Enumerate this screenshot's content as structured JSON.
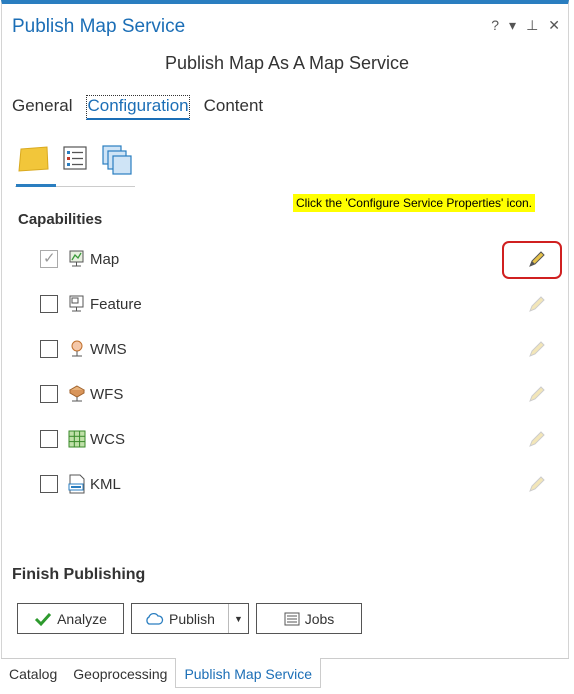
{
  "pane": {
    "title": "Publish Map Service",
    "controls": [
      "?",
      "▾",
      "⊥",
      "✕"
    ]
  },
  "subtitle": "Publish Map As A Map Service",
  "tabs": [
    {
      "label": "General",
      "active": false
    },
    {
      "label": "Configuration",
      "active": true
    },
    {
      "label": "Content",
      "active": false
    }
  ],
  "subtabs": [
    {
      "icon": "folder-icon",
      "active": true
    },
    {
      "icon": "properties-list-icon",
      "active": false
    },
    {
      "icon": "layers-stack-icon",
      "active": false
    }
  ],
  "callout": "Click the 'Configure Service Properties' icon.",
  "capabilities": {
    "title": "Capabilities",
    "items": [
      {
        "label": "Map",
        "checked": true,
        "icon": "map-service-icon"
      },
      {
        "label": "Feature",
        "checked": false,
        "icon": "feature-service-icon"
      },
      {
        "label": "WMS",
        "checked": false,
        "icon": "wms-icon"
      },
      {
        "label": "WFS",
        "checked": false,
        "icon": "wfs-icon"
      },
      {
        "label": "WCS",
        "checked": false,
        "icon": "wcs-icon"
      },
      {
        "label": "KML",
        "checked": false,
        "icon": "kml-icon"
      }
    ]
  },
  "finish": {
    "title": "Finish Publishing",
    "analyze_label": "Analyze",
    "publish_label": "Publish",
    "jobs_label": "Jobs"
  },
  "bottom_tabs": [
    {
      "label": "Catalog",
      "active": false
    },
    {
      "label": "Geoprocessing",
      "active": false
    },
    {
      "label": "Publish Map Service",
      "active": true
    }
  ],
  "colors": {
    "accent": "#1b6eb6",
    "callout_bg": "#ffff00",
    "highlight": "#d02020"
  }
}
